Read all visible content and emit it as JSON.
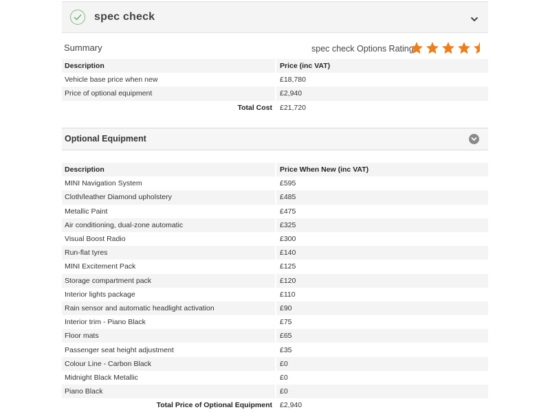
{
  "spec_check": {
    "title": "spec check",
    "summary_label": "Summary",
    "rating_label": "spec check Options Rating:",
    "rating_value": 4.5,
    "rating_max": 5,
    "rating_color": "#f07d18"
  },
  "summary_table": {
    "headers": [
      "Description",
      "Price (inc VAT)"
    ],
    "rows": [
      {
        "description": "Vehicle base price when new",
        "price": "£18,780"
      },
      {
        "description": "Price of optional equipment",
        "price": "£2,940"
      }
    ],
    "total_label": "Total Cost",
    "total_value": "£21,720"
  },
  "optional_equipment": {
    "title": "Optional Equipment",
    "headers": [
      "Description",
      "Price When New (inc VAT)"
    ],
    "rows": [
      {
        "description": "MINI Navigation System",
        "price": "£595"
      },
      {
        "description": "Cloth/leather Diamond upholstery",
        "price": "£485"
      },
      {
        "description": "Metallic Paint",
        "price": "£475"
      },
      {
        "description": "Air conditioning, dual-zone automatic",
        "price": "£325"
      },
      {
        "description": "Visual Boost Radio",
        "price": "£300"
      },
      {
        "description": "Run-flat tyres",
        "price": "£140"
      },
      {
        "description": "MINI Excitement Pack",
        "price": "£125"
      },
      {
        "description": "Storage compartment pack",
        "price": "£120"
      },
      {
        "description": "Interior lights package",
        "price": "£110"
      },
      {
        "description": "Rain sensor and automatic headlight activation",
        "price": "£90"
      },
      {
        "description": "Interior trim - Piano Black",
        "price": "£75"
      },
      {
        "description": "Floor mats",
        "price": "£65"
      },
      {
        "description": "Passenger seat height adjustment",
        "price": "£35"
      },
      {
        "description": "Colour Line - Carbon Black",
        "price": "£0"
      },
      {
        "description": "Midnight Black Metallic",
        "price": "£0"
      },
      {
        "description": "Piano Black",
        "price": "£0"
      }
    ],
    "total_label": "Total Price of Optional Equipment",
    "total_value": "£2,940"
  }
}
